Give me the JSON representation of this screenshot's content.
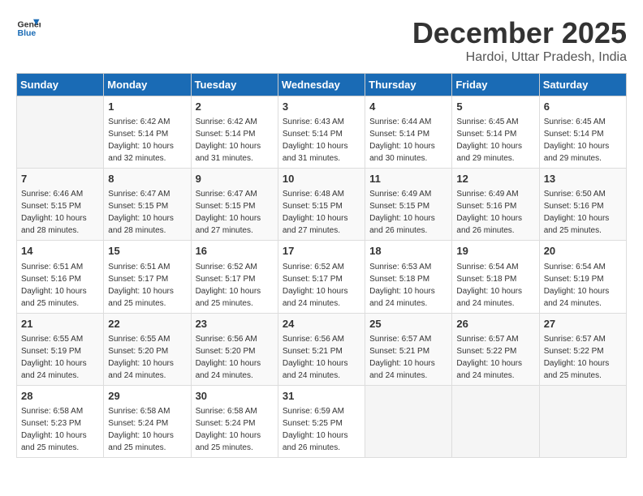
{
  "header": {
    "logo_line1": "General",
    "logo_line2": "Blue",
    "month": "December 2025",
    "location": "Hardoi, Uttar Pradesh, India"
  },
  "days_of_week": [
    "Sunday",
    "Monday",
    "Tuesday",
    "Wednesday",
    "Thursday",
    "Friday",
    "Saturday"
  ],
  "weeks": [
    [
      {
        "day": "",
        "info": ""
      },
      {
        "day": "1",
        "info": "Sunrise: 6:42 AM\nSunset: 5:14 PM\nDaylight: 10 hours\nand 32 minutes."
      },
      {
        "day": "2",
        "info": "Sunrise: 6:42 AM\nSunset: 5:14 PM\nDaylight: 10 hours\nand 31 minutes."
      },
      {
        "day": "3",
        "info": "Sunrise: 6:43 AM\nSunset: 5:14 PM\nDaylight: 10 hours\nand 31 minutes."
      },
      {
        "day": "4",
        "info": "Sunrise: 6:44 AM\nSunset: 5:14 PM\nDaylight: 10 hours\nand 30 minutes."
      },
      {
        "day": "5",
        "info": "Sunrise: 6:45 AM\nSunset: 5:14 PM\nDaylight: 10 hours\nand 29 minutes."
      },
      {
        "day": "6",
        "info": "Sunrise: 6:45 AM\nSunset: 5:14 PM\nDaylight: 10 hours\nand 29 minutes."
      }
    ],
    [
      {
        "day": "7",
        "info": "Sunrise: 6:46 AM\nSunset: 5:15 PM\nDaylight: 10 hours\nand 28 minutes."
      },
      {
        "day": "8",
        "info": "Sunrise: 6:47 AM\nSunset: 5:15 PM\nDaylight: 10 hours\nand 28 minutes."
      },
      {
        "day": "9",
        "info": "Sunrise: 6:47 AM\nSunset: 5:15 PM\nDaylight: 10 hours\nand 27 minutes."
      },
      {
        "day": "10",
        "info": "Sunrise: 6:48 AM\nSunset: 5:15 PM\nDaylight: 10 hours\nand 27 minutes."
      },
      {
        "day": "11",
        "info": "Sunrise: 6:49 AM\nSunset: 5:15 PM\nDaylight: 10 hours\nand 26 minutes."
      },
      {
        "day": "12",
        "info": "Sunrise: 6:49 AM\nSunset: 5:16 PM\nDaylight: 10 hours\nand 26 minutes."
      },
      {
        "day": "13",
        "info": "Sunrise: 6:50 AM\nSunset: 5:16 PM\nDaylight: 10 hours\nand 25 minutes."
      }
    ],
    [
      {
        "day": "14",
        "info": "Sunrise: 6:51 AM\nSunset: 5:16 PM\nDaylight: 10 hours\nand 25 minutes."
      },
      {
        "day": "15",
        "info": "Sunrise: 6:51 AM\nSunset: 5:17 PM\nDaylight: 10 hours\nand 25 minutes."
      },
      {
        "day": "16",
        "info": "Sunrise: 6:52 AM\nSunset: 5:17 PM\nDaylight: 10 hours\nand 25 minutes."
      },
      {
        "day": "17",
        "info": "Sunrise: 6:52 AM\nSunset: 5:17 PM\nDaylight: 10 hours\nand 24 minutes."
      },
      {
        "day": "18",
        "info": "Sunrise: 6:53 AM\nSunset: 5:18 PM\nDaylight: 10 hours\nand 24 minutes."
      },
      {
        "day": "19",
        "info": "Sunrise: 6:54 AM\nSunset: 5:18 PM\nDaylight: 10 hours\nand 24 minutes."
      },
      {
        "day": "20",
        "info": "Sunrise: 6:54 AM\nSunset: 5:19 PM\nDaylight: 10 hours\nand 24 minutes."
      }
    ],
    [
      {
        "day": "21",
        "info": "Sunrise: 6:55 AM\nSunset: 5:19 PM\nDaylight: 10 hours\nand 24 minutes."
      },
      {
        "day": "22",
        "info": "Sunrise: 6:55 AM\nSunset: 5:20 PM\nDaylight: 10 hours\nand 24 minutes."
      },
      {
        "day": "23",
        "info": "Sunrise: 6:56 AM\nSunset: 5:20 PM\nDaylight: 10 hours\nand 24 minutes."
      },
      {
        "day": "24",
        "info": "Sunrise: 6:56 AM\nSunset: 5:21 PM\nDaylight: 10 hours\nand 24 minutes."
      },
      {
        "day": "25",
        "info": "Sunrise: 6:57 AM\nSunset: 5:21 PM\nDaylight: 10 hours\nand 24 minutes."
      },
      {
        "day": "26",
        "info": "Sunrise: 6:57 AM\nSunset: 5:22 PM\nDaylight: 10 hours\nand 24 minutes."
      },
      {
        "day": "27",
        "info": "Sunrise: 6:57 AM\nSunset: 5:22 PM\nDaylight: 10 hours\nand 25 minutes."
      }
    ],
    [
      {
        "day": "28",
        "info": "Sunrise: 6:58 AM\nSunset: 5:23 PM\nDaylight: 10 hours\nand 25 minutes."
      },
      {
        "day": "29",
        "info": "Sunrise: 6:58 AM\nSunset: 5:24 PM\nDaylight: 10 hours\nand 25 minutes."
      },
      {
        "day": "30",
        "info": "Sunrise: 6:58 AM\nSunset: 5:24 PM\nDaylight: 10 hours\nand 25 minutes."
      },
      {
        "day": "31",
        "info": "Sunrise: 6:59 AM\nSunset: 5:25 PM\nDaylight: 10 hours\nand 26 minutes."
      },
      {
        "day": "",
        "info": ""
      },
      {
        "day": "",
        "info": ""
      },
      {
        "day": "",
        "info": ""
      }
    ]
  ]
}
